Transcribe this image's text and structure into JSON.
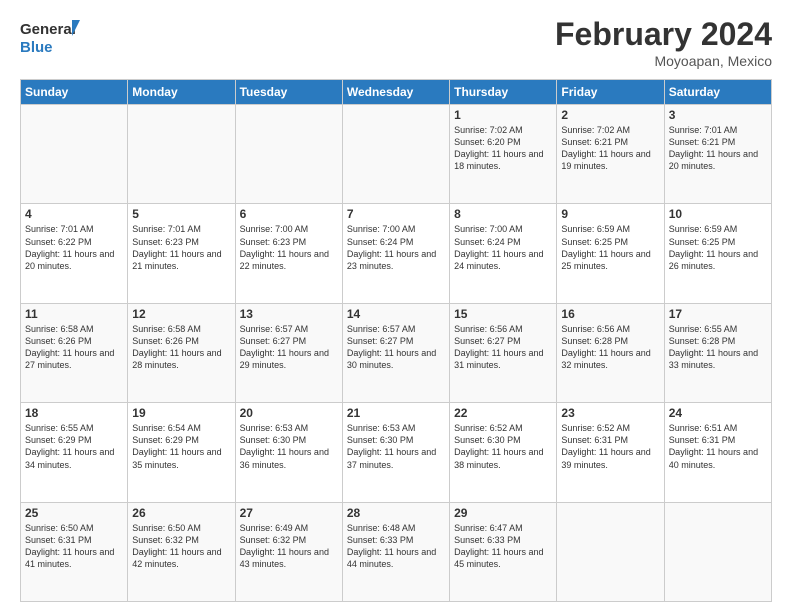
{
  "header": {
    "logo_line1": "General",
    "logo_line2": "Blue",
    "month_title": "February 2024",
    "location": "Moyoapan, Mexico"
  },
  "days_of_week": [
    "Sunday",
    "Monday",
    "Tuesday",
    "Wednesday",
    "Thursday",
    "Friday",
    "Saturday"
  ],
  "weeks": [
    [
      {
        "day": "",
        "info": ""
      },
      {
        "day": "",
        "info": ""
      },
      {
        "day": "",
        "info": ""
      },
      {
        "day": "",
        "info": ""
      },
      {
        "day": "1",
        "info": "Sunrise: 7:02 AM\nSunset: 6:20 PM\nDaylight: 11 hours and 18 minutes."
      },
      {
        "day": "2",
        "info": "Sunrise: 7:02 AM\nSunset: 6:21 PM\nDaylight: 11 hours and 19 minutes."
      },
      {
        "day": "3",
        "info": "Sunrise: 7:01 AM\nSunset: 6:21 PM\nDaylight: 11 hours and 20 minutes."
      }
    ],
    [
      {
        "day": "4",
        "info": "Sunrise: 7:01 AM\nSunset: 6:22 PM\nDaylight: 11 hours and 20 minutes."
      },
      {
        "day": "5",
        "info": "Sunrise: 7:01 AM\nSunset: 6:23 PM\nDaylight: 11 hours and 21 minutes."
      },
      {
        "day": "6",
        "info": "Sunrise: 7:00 AM\nSunset: 6:23 PM\nDaylight: 11 hours and 22 minutes."
      },
      {
        "day": "7",
        "info": "Sunrise: 7:00 AM\nSunset: 6:24 PM\nDaylight: 11 hours and 23 minutes."
      },
      {
        "day": "8",
        "info": "Sunrise: 7:00 AM\nSunset: 6:24 PM\nDaylight: 11 hours and 24 minutes."
      },
      {
        "day": "9",
        "info": "Sunrise: 6:59 AM\nSunset: 6:25 PM\nDaylight: 11 hours and 25 minutes."
      },
      {
        "day": "10",
        "info": "Sunrise: 6:59 AM\nSunset: 6:25 PM\nDaylight: 11 hours and 26 minutes."
      }
    ],
    [
      {
        "day": "11",
        "info": "Sunrise: 6:58 AM\nSunset: 6:26 PM\nDaylight: 11 hours and 27 minutes."
      },
      {
        "day": "12",
        "info": "Sunrise: 6:58 AM\nSunset: 6:26 PM\nDaylight: 11 hours and 28 minutes."
      },
      {
        "day": "13",
        "info": "Sunrise: 6:57 AM\nSunset: 6:27 PM\nDaylight: 11 hours and 29 minutes."
      },
      {
        "day": "14",
        "info": "Sunrise: 6:57 AM\nSunset: 6:27 PM\nDaylight: 11 hours and 30 minutes."
      },
      {
        "day": "15",
        "info": "Sunrise: 6:56 AM\nSunset: 6:27 PM\nDaylight: 11 hours and 31 minutes."
      },
      {
        "day": "16",
        "info": "Sunrise: 6:56 AM\nSunset: 6:28 PM\nDaylight: 11 hours and 32 minutes."
      },
      {
        "day": "17",
        "info": "Sunrise: 6:55 AM\nSunset: 6:28 PM\nDaylight: 11 hours and 33 minutes."
      }
    ],
    [
      {
        "day": "18",
        "info": "Sunrise: 6:55 AM\nSunset: 6:29 PM\nDaylight: 11 hours and 34 minutes."
      },
      {
        "day": "19",
        "info": "Sunrise: 6:54 AM\nSunset: 6:29 PM\nDaylight: 11 hours and 35 minutes."
      },
      {
        "day": "20",
        "info": "Sunrise: 6:53 AM\nSunset: 6:30 PM\nDaylight: 11 hours and 36 minutes."
      },
      {
        "day": "21",
        "info": "Sunrise: 6:53 AM\nSunset: 6:30 PM\nDaylight: 11 hours and 37 minutes."
      },
      {
        "day": "22",
        "info": "Sunrise: 6:52 AM\nSunset: 6:30 PM\nDaylight: 11 hours and 38 minutes."
      },
      {
        "day": "23",
        "info": "Sunrise: 6:52 AM\nSunset: 6:31 PM\nDaylight: 11 hours and 39 minutes."
      },
      {
        "day": "24",
        "info": "Sunrise: 6:51 AM\nSunset: 6:31 PM\nDaylight: 11 hours and 40 minutes."
      }
    ],
    [
      {
        "day": "25",
        "info": "Sunrise: 6:50 AM\nSunset: 6:31 PM\nDaylight: 11 hours and 41 minutes."
      },
      {
        "day": "26",
        "info": "Sunrise: 6:50 AM\nSunset: 6:32 PM\nDaylight: 11 hours and 42 minutes."
      },
      {
        "day": "27",
        "info": "Sunrise: 6:49 AM\nSunset: 6:32 PM\nDaylight: 11 hours and 43 minutes."
      },
      {
        "day": "28",
        "info": "Sunrise: 6:48 AM\nSunset: 6:33 PM\nDaylight: 11 hours and 44 minutes."
      },
      {
        "day": "29",
        "info": "Sunrise: 6:47 AM\nSunset: 6:33 PM\nDaylight: 11 hours and 45 minutes."
      },
      {
        "day": "",
        "info": ""
      },
      {
        "day": "",
        "info": ""
      }
    ]
  ]
}
